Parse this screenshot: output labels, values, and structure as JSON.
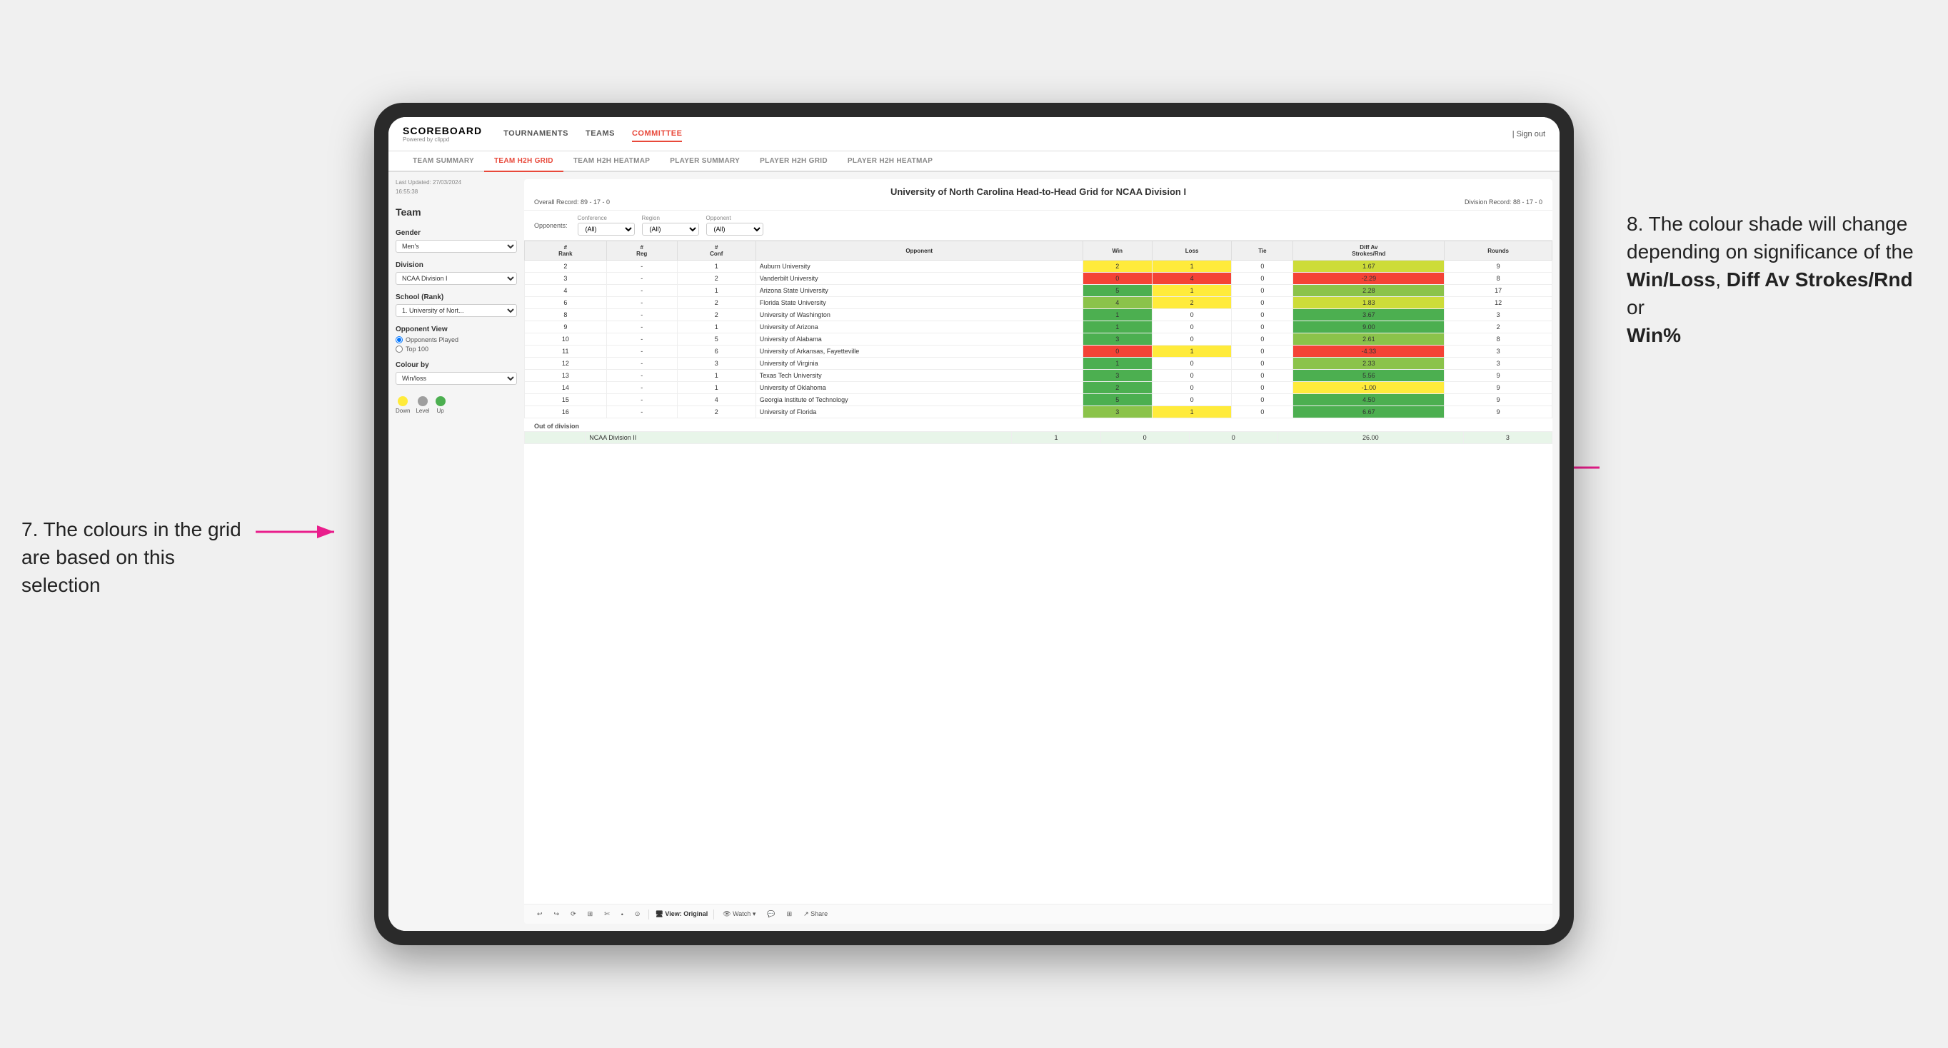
{
  "annotations": {
    "left_number": "7.",
    "left_text": "The colours in the grid are based on this selection",
    "right_number": "8.",
    "right_text": "The colour shade will change depending on significance of the",
    "right_bold1": "Win/Loss",
    "right_comma": ", ",
    "right_bold2": "Diff Av Strokes/Rnd",
    "right_or": " or",
    "right_bold3": "Win%"
  },
  "nav": {
    "logo": "SCOREBOARD",
    "logo_sub": "Powered by clippd",
    "items": [
      "TOURNAMENTS",
      "TEAMS",
      "COMMITTEE"
    ],
    "active": "COMMITTEE",
    "sign_out": "| Sign out"
  },
  "sub_nav": {
    "items": [
      "TEAM SUMMARY",
      "TEAM H2H GRID",
      "TEAM H2H HEATMAP",
      "PLAYER SUMMARY",
      "PLAYER H2H GRID",
      "PLAYER H2H HEATMAP"
    ],
    "active": "TEAM H2H GRID"
  },
  "sidebar": {
    "last_updated_label": "Last Updated: 27/03/2024",
    "last_updated_time": "16:55:38",
    "team_label": "Team",
    "gender_label": "Gender",
    "gender_value": "Men's",
    "division_label": "Division",
    "division_value": "NCAA Division I",
    "school_rank_label": "School (Rank)",
    "school_rank_value": "1. University of Nort...",
    "opponent_view_label": "Opponent View",
    "radio_options": [
      "Opponents Played",
      "Top 100"
    ],
    "radio_selected": "Opponents Played",
    "colour_by_label": "Colour by",
    "colour_by_value": "Win/loss",
    "legend": [
      {
        "label": "Down",
        "color": "#ffeb3b"
      },
      {
        "label": "Level",
        "color": "#9e9e9e"
      },
      {
        "label": "Up",
        "color": "#4caf50"
      }
    ]
  },
  "grid": {
    "title": "University of North Carolina Head-to-Head Grid for NCAA Division I",
    "overall_record": "Overall Record: 89 - 17 - 0",
    "division_record": "Division Record: 88 - 17 - 0",
    "filters": {
      "opponents_label": "Opponents:",
      "conference_label": "Conference",
      "conference_value": "(All)",
      "region_label": "Region",
      "region_value": "(All)",
      "opponent_label": "Opponent",
      "opponent_value": "(All)"
    },
    "columns": [
      "#\nRank",
      "#\nReg",
      "#\nConf",
      "Opponent",
      "Win",
      "Loss",
      "Tie",
      "Diff Av\nStrokes/Rnd",
      "Rounds"
    ],
    "rows": [
      {
        "rank": "2",
        "reg": "-",
        "conf": "1",
        "opponent": "Auburn University",
        "win": "2",
        "loss": "1",
        "tie": "0",
        "diff": "1.67",
        "rounds": "9",
        "win_color": "yellow",
        "diff_color": "green_light"
      },
      {
        "rank": "3",
        "reg": "-",
        "conf": "2",
        "opponent": "Vanderbilt University",
        "win": "0",
        "loss": "4",
        "tie": "0",
        "diff": "-2.29",
        "rounds": "8",
        "win_color": "red",
        "diff_color": "red"
      },
      {
        "rank": "4",
        "reg": "-",
        "conf": "1",
        "opponent": "Arizona State University",
        "win": "5",
        "loss": "1",
        "tie": "0",
        "diff": "2.28",
        "rounds": "17",
        "win_color": "green_dark",
        "diff_color": "green_mid"
      },
      {
        "rank": "6",
        "reg": "-",
        "conf": "2",
        "opponent": "Florida State University",
        "win": "4",
        "loss": "2",
        "tie": "0",
        "diff": "1.83",
        "rounds": "12",
        "win_color": "green_mid",
        "diff_color": "green_light"
      },
      {
        "rank": "8",
        "reg": "-",
        "conf": "2",
        "opponent": "University of Washington",
        "win": "1",
        "loss": "0",
        "tie": "0",
        "diff": "3.67",
        "rounds": "3",
        "win_color": "green_dark",
        "diff_color": "green_dark"
      },
      {
        "rank": "9",
        "reg": "-",
        "conf": "1",
        "opponent": "University of Arizona",
        "win": "1",
        "loss": "0",
        "tie": "0",
        "diff": "9.00",
        "rounds": "2",
        "win_color": "green_dark",
        "diff_color": "green_dark"
      },
      {
        "rank": "10",
        "reg": "-",
        "conf": "5",
        "opponent": "University of Alabama",
        "win": "3",
        "loss": "0",
        "tie": "0",
        "diff": "2.61",
        "rounds": "8",
        "win_color": "green_dark",
        "diff_color": "green_mid"
      },
      {
        "rank": "11",
        "reg": "-",
        "conf": "6",
        "opponent": "University of Arkansas, Fayetteville",
        "win": "0",
        "loss": "1",
        "tie": "0",
        "diff": "-4.33",
        "rounds": "3",
        "win_color": "red",
        "diff_color": "red"
      },
      {
        "rank": "12",
        "reg": "-",
        "conf": "3",
        "opponent": "University of Virginia",
        "win": "1",
        "loss": "0",
        "tie": "0",
        "diff": "2.33",
        "rounds": "3",
        "win_color": "green_dark",
        "diff_color": "green_mid"
      },
      {
        "rank": "13",
        "reg": "-",
        "conf": "1",
        "opponent": "Texas Tech University",
        "win": "3",
        "loss": "0",
        "tie": "0",
        "diff": "5.56",
        "rounds": "9",
        "win_color": "green_dark",
        "diff_color": "green_dark"
      },
      {
        "rank": "14",
        "reg": "-",
        "conf": "1",
        "opponent": "University of Oklahoma",
        "win": "2",
        "loss": "0",
        "tie": "0",
        "diff": "-1.00",
        "rounds": "9",
        "win_color": "green_dark",
        "diff_color": "yellow"
      },
      {
        "rank": "15",
        "reg": "-",
        "conf": "4",
        "opponent": "Georgia Institute of Technology",
        "win": "5",
        "loss": "0",
        "tie": "0",
        "diff": "4.50",
        "rounds": "9",
        "win_color": "green_dark",
        "diff_color": "green_dark"
      },
      {
        "rank": "16",
        "reg": "-",
        "conf": "2",
        "opponent": "University of Florida",
        "win": "3",
        "loss": "1",
        "tie": "0",
        "diff": "6.67",
        "rounds": "9",
        "win_color": "green_mid",
        "diff_color": "green_dark"
      }
    ],
    "out_division_label": "Out of division",
    "out_division_rows": [
      {
        "label": "NCAA Division II",
        "win": "1",
        "loss": "0",
        "tie": "0",
        "diff": "26.00",
        "rounds": "3"
      }
    ]
  },
  "toolbar": {
    "buttons": [
      "↩",
      "↪",
      "⟳",
      "⊞",
      "✄",
      "•",
      "⊙"
    ],
    "view_label": "View: Original",
    "watch_label": "Watch ▾",
    "share_label": "Share"
  }
}
